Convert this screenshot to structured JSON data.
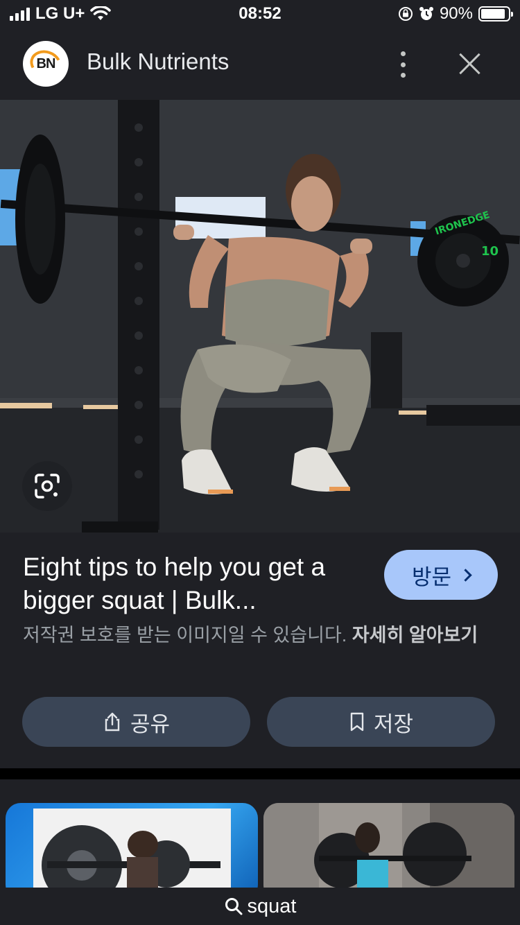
{
  "status_bar": {
    "carrier": "LG U+",
    "time": "08:52",
    "battery": "90%",
    "battery_level": 0.9
  },
  "header": {
    "logo_text": "BN",
    "site_name": "Bulk Nutrients"
  },
  "hero": {
    "plate_brand": "IRONEDGE",
    "plate_weight": "10"
  },
  "result": {
    "title": "Eight tips to help you get a bigger squat | Bulk...",
    "visit_label": "방문",
    "copyright_notice": "저작권 보호를 받는 이미지일 수 있습니다.",
    "learn_more": "자세히 알아보기",
    "share_label": "공유",
    "save_label": "저장"
  },
  "search": {
    "query": "squat"
  },
  "colors": {
    "background": "#1f2025",
    "visit_button": "#a8c7fa",
    "action_button": "#3a4556",
    "plate_accent": "#1fc34d"
  },
  "icons": [
    "wifi-icon",
    "orientation-lock-icon",
    "alarm-icon",
    "more-vert-icon",
    "close-icon",
    "lens-icon",
    "share-icon",
    "bookmark-icon",
    "search-icon",
    "chevron-right-icon"
  ]
}
